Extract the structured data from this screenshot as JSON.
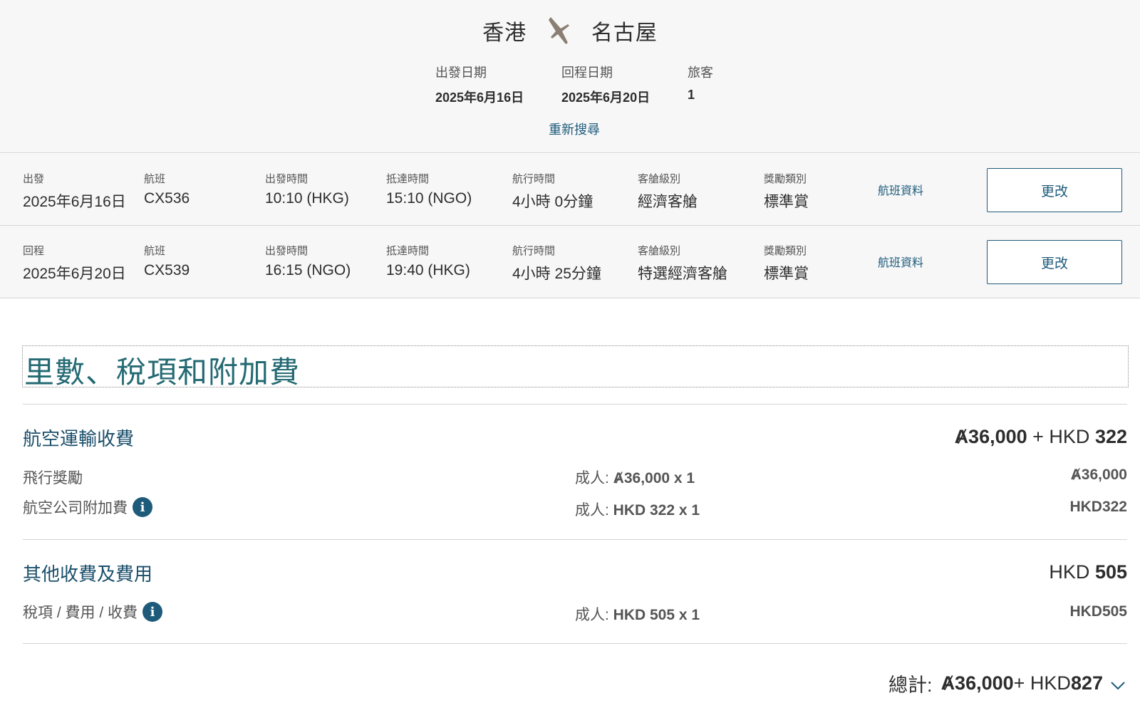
{
  "summary": {
    "origin": "香港",
    "destination": "名古屋",
    "depart_label": "出發日期",
    "depart_value": "2025年6月16日",
    "return_label": "回程日期",
    "return_value": "2025年6月20日",
    "pax_label": "旅客",
    "pax_value": "1",
    "research_link": "重新搜尋",
    "route_icon": "plane-icon"
  },
  "flights": [
    {
      "dir_label": "出發",
      "date": "2025年6月16日",
      "flight_label": "航班",
      "flight_no": "CX536",
      "dep_label": "出發時間",
      "dep_time": "10:10 (HKG)",
      "arr_label": "抵達時間",
      "arr_time": "15:10 (NGO)",
      "dur_label": "航行時間",
      "duration": "4小時 0分鐘",
      "cabin_label": "客艙級別",
      "cabin": "經濟客艙",
      "award_label": "獎勵類別",
      "award": "標準賞",
      "details_link": "航班資料",
      "change_label": "更改"
    },
    {
      "dir_label": "回程",
      "date": "2025年6月20日",
      "flight_label": "航班",
      "flight_no": "CX539",
      "dep_label": "出發時間",
      "dep_time": "16:15 (NGO)",
      "arr_label": "抵達時間",
      "arr_time": "19:40 (HKG)",
      "dur_label": "航行時間",
      "duration": "4小時 25分鐘",
      "cabin_label": "客艙級別",
      "cabin": "特選經濟客艙",
      "award_label": "獎勵類別",
      "award": "標準賞",
      "details_link": "航班資料",
      "change_label": "更改"
    }
  ],
  "fare": {
    "title": "里數、稅項和附加費",
    "air": {
      "title": "航空運輸收費",
      "amount_miles": "Ⱥ36,000",
      "amount_plus": " + HKD ",
      "amount_hkd": "322",
      "rows": [
        {
          "label": "飛行獎勵",
          "mid_prefix": "成人: ",
          "mid_value": "Ⱥ36,000 x 1",
          "right": "Ⱥ36,000",
          "info": false
        },
        {
          "label": "航空公司附加費",
          "mid_prefix": "成人: ",
          "mid_value": "HKD 322 x 1",
          "right": "HKD322",
          "info": true
        }
      ]
    },
    "other": {
      "title": "其他收費及費用",
      "amount_prefix": "HKD ",
      "amount_value": "505",
      "rows": [
        {
          "label": "稅項 / 費用 / 收費",
          "mid_prefix": "成人: ",
          "mid_value": "HKD 505 x 1",
          "right": "HKD505",
          "info": true
        }
      ]
    },
    "total": {
      "label": "總計:",
      "miles": "Ⱥ36,000",
      "plus": " + HKD ",
      "hkd": "827"
    },
    "info_glyph": "i"
  },
  "colors": {
    "accent": "#1e5b7b",
    "title_teal": "#246a73",
    "panel_bg": "#f7f7f7"
  }
}
